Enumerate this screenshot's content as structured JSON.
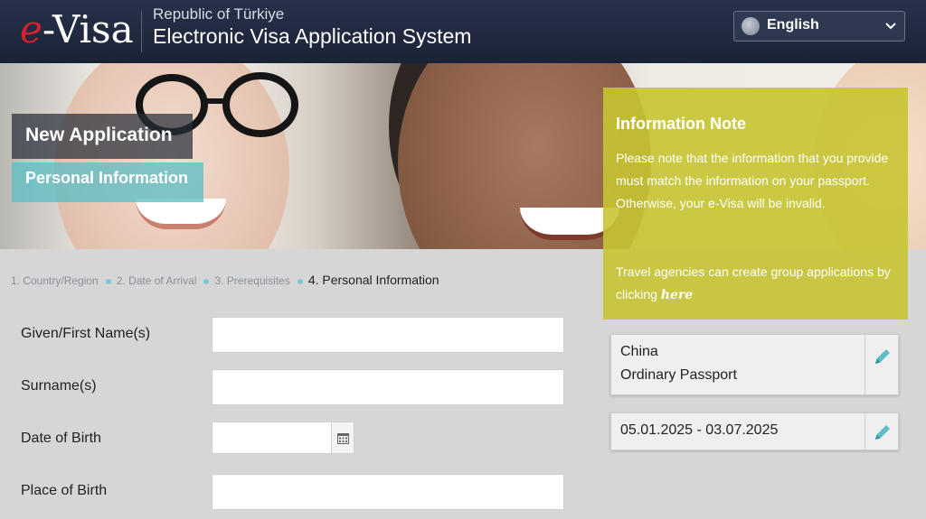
{
  "header": {
    "logo_e": "e",
    "logo_visa": "-Visa",
    "republic": "Republic of Türkiye",
    "system_title": "Electronic Visa Application System",
    "language": "English"
  },
  "hero": {
    "new_application": "New Application",
    "section_title": "Personal Information"
  },
  "info_note": {
    "title": "Information Note",
    "text": "Please note that the information that you provide must match the information on your passport. Otherwise, your e-Visa will be invalid.",
    "group_text": "Travel agencies can create group applications by clicking",
    "link": "here"
  },
  "steps": [
    {
      "label": "1. Country/Region"
    },
    {
      "label": "2. Date of Arrival"
    },
    {
      "label": "3. Prerequisites"
    },
    {
      "label": "4. Personal Information"
    }
  ],
  "form": {
    "given_name_label": "Given/First Name(s)",
    "surname_label": "Surname(s)",
    "dob_label": "Date of Birth",
    "pob_label": "Place of Birth",
    "given_name_value": "",
    "surname_value": "",
    "dob_value": "",
    "pob_value": ""
  },
  "summary": {
    "country": "China",
    "passport_type": "Ordinary Passport",
    "dates": "05.01.2025 - 03.07.2025"
  },
  "colors": {
    "header_bg": "#1f2840",
    "accent_teal": "#5fbec4",
    "info_yellow": "#c6c432",
    "logo_red": "#d2232a"
  }
}
